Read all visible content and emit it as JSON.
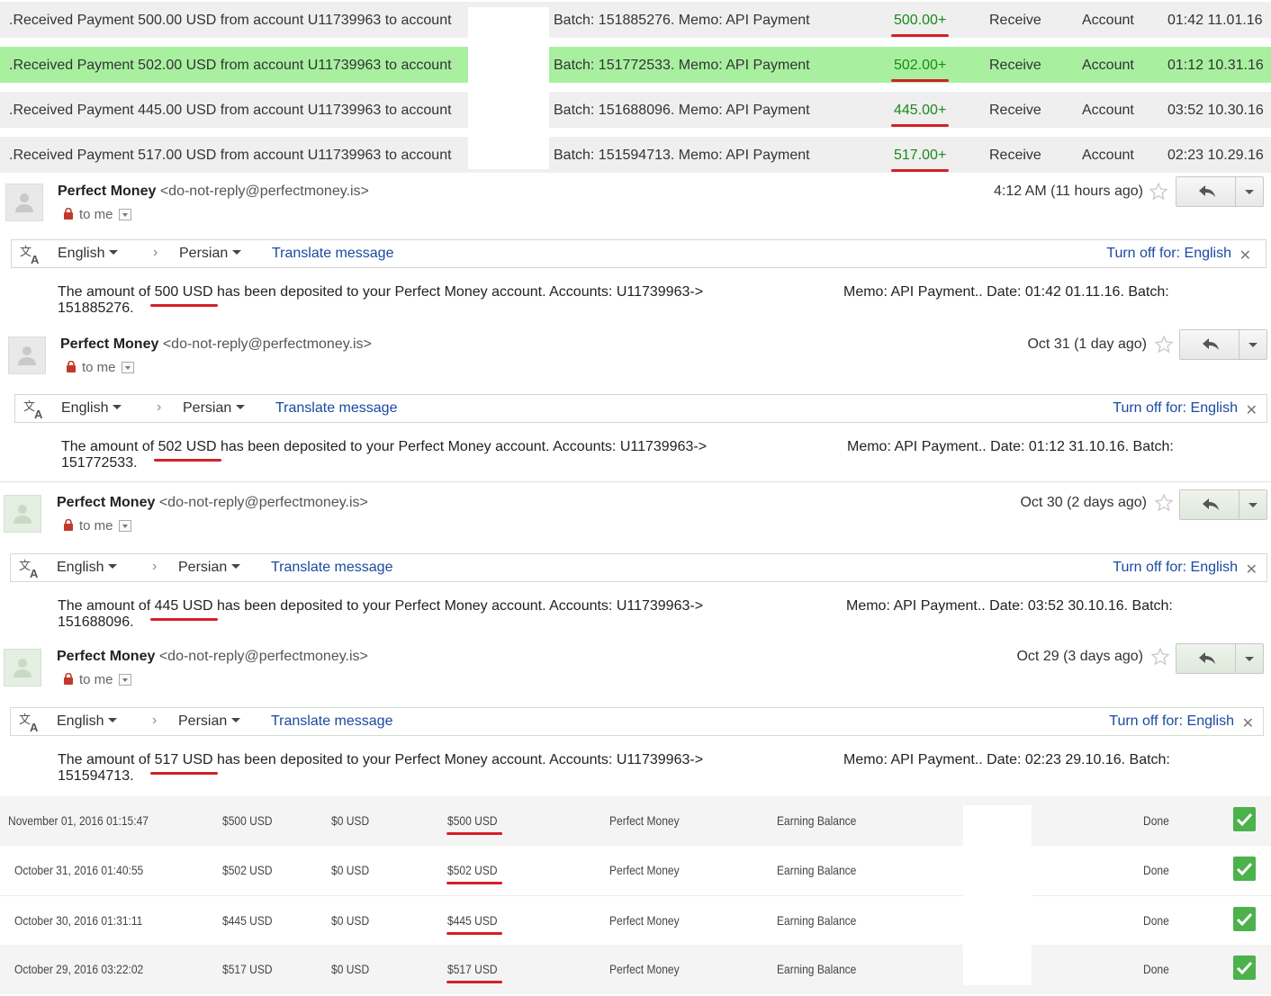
{
  "transactions": [
    {
      "desc": ".Received Payment 500.00 USD from account U11739963 to account",
      "batch": "Batch: 151885276. Memo: API Payment",
      "amount": "500.00+",
      "type": "Receive",
      "account": "Account",
      "time": "01:42 11.01.16",
      "highlight": false
    },
    {
      "desc": ".Received Payment 502.00 USD from account U11739963 to account",
      "batch": "Batch: 151772533. Memo: API Payment",
      "amount": "502.00+",
      "type": "Receive",
      "account": "Account",
      "time": "01:12 10.31.16",
      "highlight": true
    },
    {
      "desc": ".Received Payment 445.00 USD from account U11739963 to account",
      "batch": "Batch: 151688096. Memo: API Payment",
      "amount": "445.00+",
      "type": "Receive",
      "account": "Account",
      "time": "03:52 10.30.16",
      "highlight": false
    },
    {
      "desc": ".Received Payment 517.00 USD from account U11739963 to account",
      "batch": "Batch: 151594713. Memo: API Payment",
      "amount": "517.00+",
      "type": "Receive",
      "account": "Account",
      "time": "02:23 10.29.16",
      "highlight": false
    }
  ],
  "emails": [
    {
      "sender_name": "Perfect Money",
      "sender_email": "<do-not-reply@perfectmoney.is>",
      "to": "to me",
      "date": "4:12 AM (11 hours ago)",
      "translate": {
        "from": "English",
        "to": "Persian",
        "action": "Translate message",
        "turn_off": "Turn off for: English"
      },
      "body_pre": "The amount of ",
      "amount": "500 USD",
      "body_post": " has been deposited to your Perfect Money account. Accounts: U11739963->",
      "body_line2": "151885276.",
      "memo": "Memo: API Payment.. Date: 01:42 01.11.16. Batch:"
    },
    {
      "sender_name": "Perfect Money",
      "sender_email": "<do-not-reply@perfectmoney.is>",
      "to": "to me",
      "date": "Oct 31 (1 day ago)",
      "translate": {
        "from": "English",
        "to": "Persian",
        "action": "Translate message",
        "turn_off": "Turn off for: English"
      },
      "body_pre": "The amount of ",
      "amount": "502 USD",
      "body_post": " has been deposited to your Perfect Money account. Accounts: U11739963->",
      "body_line2": "151772533.",
      "memo": "Memo: API Payment.. Date: 01:12 31.10.16. Batch:"
    },
    {
      "sender_name": "Perfect Money",
      "sender_email": "<do-not-reply@perfectmoney.is>",
      "to": "to me",
      "date": "Oct 30 (2 days ago)",
      "translate": {
        "from": "English",
        "to": "Persian",
        "action": "Translate message",
        "turn_off": "Turn off for: English"
      },
      "body_pre": "The amount of ",
      "amount": "445 USD",
      "body_post": " has been deposited to your Perfect Money account. Accounts: U11739963->",
      "body_line2": "151688096.",
      "memo": "Memo: API Payment.. Date: 03:52 30.10.16. Batch:"
    },
    {
      "sender_name": "Perfect Money",
      "sender_email": "<do-not-reply@perfectmoney.is>",
      "to": "to me",
      "date": "Oct 29 (3 days ago)",
      "translate": {
        "from": "English",
        "to": "Persian",
        "action": "Translate message",
        "turn_off": "Turn off for: English"
      },
      "body_pre": "The amount of ",
      "amount": "517 USD",
      "body_post": " has been deposited to your Perfect Money account. Accounts: U11739963->",
      "body_line2": "151594713.",
      "memo": "Memo: API Payment.. Date: 02:23 29.10.16. Batch:"
    }
  ],
  "deposits": [
    {
      "date": "November 01, 2016 01:15:47",
      "amount": "$500 USD",
      "fee": "$0 USD",
      "net": "$500 USD",
      "system": "Perfect Money",
      "balance": "Earning Balance",
      "status": "Done"
    },
    {
      "date": "October 31, 2016 01:40:55",
      "amount": "$502 USD",
      "fee": "$0 USD",
      "net": "$502 USD",
      "system": "Perfect Money",
      "balance": "Earning Balance",
      "status": "Done"
    },
    {
      "date": "October 30, 2016 01:31:11",
      "amount": "$445 USD",
      "fee": "$0 USD",
      "net": "$445 USD",
      "system": "Perfect Money",
      "balance": "Earning Balance",
      "status": "Done"
    },
    {
      "date": "October 29, 2016 03:22:02",
      "amount": "$517 USD",
      "fee": "$0 USD",
      "net": "$517 USD",
      "system": "Perfect Money",
      "balance": "Earning Balance",
      "status": "Done"
    }
  ],
  "colors": {
    "highlight_row": "#a8f0a0",
    "gray_row": "#efefef",
    "underline": "#d32027",
    "amount_green": "#1a8a1a",
    "link_blue": "#1a4aa0",
    "check_green": "#4cb24c"
  },
  "icons": {
    "avatar": "person-icon",
    "lock": "lock-icon",
    "star": "star-icon",
    "reply": "reply-icon",
    "translate": "translate-icon",
    "check": "check-icon"
  }
}
